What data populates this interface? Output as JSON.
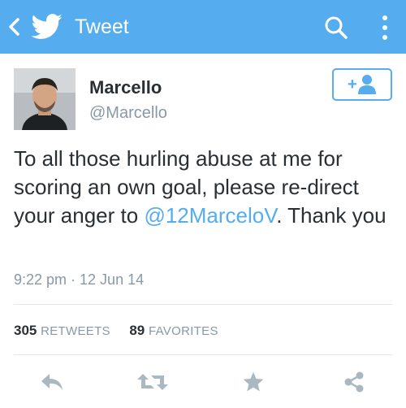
{
  "app_bar": {
    "title": "Tweet",
    "background_color": "#55acee",
    "back_icon": "chevron-left-icon",
    "logo_icon": "twitter-bird-icon",
    "search_icon": "search-icon",
    "menu_icon": "more-vertical-icon"
  },
  "tweet": {
    "author_name": "Marcello",
    "author_handle": "@Marcello",
    "follow_icon": "add-user-icon",
    "follow_label": "+",
    "text_before": "To all those hurling abuse at me for scoring an own goal, please re-direct your anger to ",
    "mention": "@12MarceloV",
    "text_after": ". Thank you",
    "timestamp": "9:22 pm · 12 Jun 14"
  },
  "stats": {
    "retweets_count": "305",
    "retweets_label": "RETWEETS",
    "favorites_count": "89",
    "favorites_label": "FAVORITES"
  },
  "actions": [
    {
      "icon": "reply-icon"
    },
    {
      "icon": "retweet-icon"
    },
    {
      "icon": "favorite-star-icon"
    },
    {
      "icon": "share-icon"
    }
  ],
  "colors": {
    "accent": "#55acee",
    "text": "#292f33",
    "secondary_text": "#8899a6",
    "icon_gray": "#aab8c2",
    "divider": "#e1e8ed"
  }
}
